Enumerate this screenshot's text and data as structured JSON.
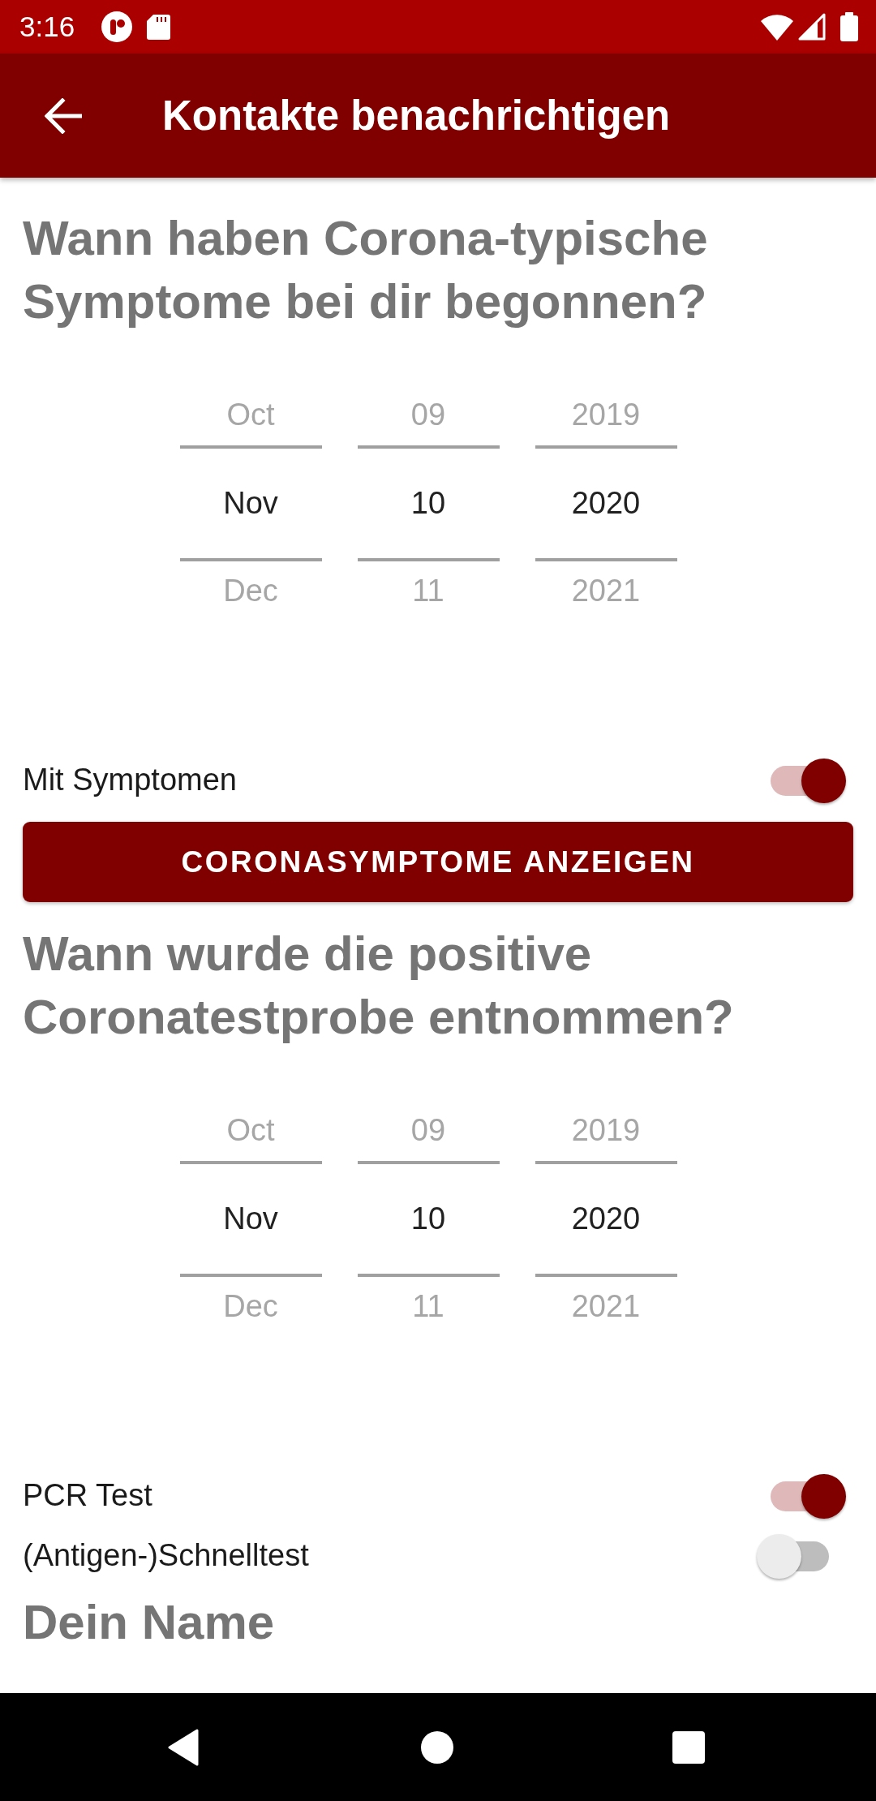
{
  "status_bar": {
    "time": "3:16"
  },
  "app_bar": {
    "title": "Kontakte benachrichtigen"
  },
  "content": [
    {
      "kind": "heading",
      "text": "Wann haben Corona-typische Symptome bei dir begonnen?"
    },
    {
      "kind": "date_picker",
      "columns": [
        {
          "values": [
            {
              "text": "Oct",
              "selected": false
            },
            {
              "text": "Nov",
              "selected": true
            },
            {
              "text": "Dec",
              "selected": false
            }
          ]
        },
        {
          "values": [
            {
              "text": "09",
              "selected": false
            },
            {
              "text": "10",
              "selected": true
            },
            {
              "text": "11",
              "selected": false
            }
          ]
        },
        {
          "values": [
            {
              "text": "2019",
              "selected": false
            },
            {
              "text": "2020",
              "selected": true
            },
            {
              "text": "2021",
              "selected": false
            }
          ]
        }
      ]
    },
    {
      "kind": "switch",
      "label": "Mit Symptomen",
      "on": true
    },
    {
      "kind": "button",
      "label": "CORONASYMPTOME ANZEIGEN"
    },
    {
      "kind": "heading",
      "text": "Wann wurde die positive Coronatestprobe entnommen?"
    },
    {
      "kind": "date_picker",
      "columns": [
        {
          "values": [
            {
              "text": "Oct",
              "selected": false
            },
            {
              "text": "Nov",
              "selected": true
            },
            {
              "text": "Dec",
              "selected": false
            }
          ]
        },
        {
          "values": [
            {
              "text": "09",
              "selected": false
            },
            {
              "text": "10",
              "selected": true
            },
            {
              "text": "11",
              "selected": false
            }
          ]
        },
        {
          "values": [
            {
              "text": "2019",
              "selected": false
            },
            {
              "text": "2020",
              "selected": true
            },
            {
              "text": "2021",
              "selected": false
            }
          ]
        }
      ]
    },
    {
      "kind": "switch",
      "label": "PCR Test",
      "on": true
    },
    {
      "kind": "switch",
      "label": "(Antigen-)Schnelltest",
      "on": false
    },
    {
      "kind": "heading",
      "text": "Dein Name"
    }
  ]
}
